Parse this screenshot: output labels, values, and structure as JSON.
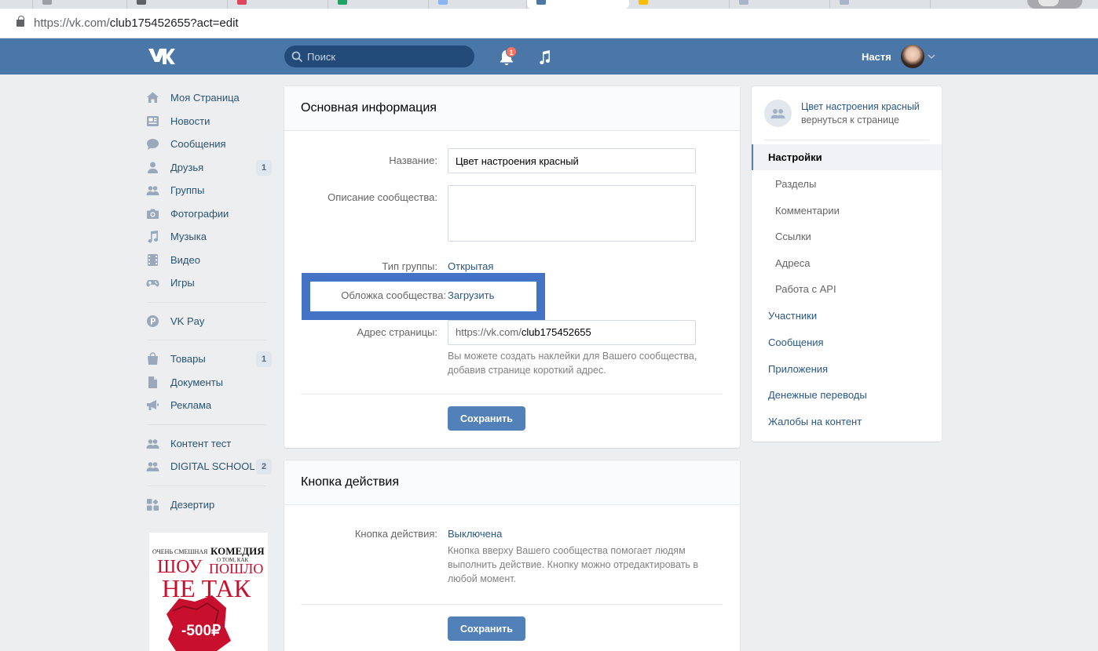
{
  "browser": {
    "url_host": "https://vk.com/",
    "url_path": "club175452655?act=edit"
  },
  "header": {
    "search_placeholder": "Поиск",
    "notifications_count": "1",
    "user_name": "Настя"
  },
  "left_nav": {
    "items": [
      {
        "label": "Моя Страница",
        "icon": "home-icon"
      },
      {
        "label": "Новости",
        "icon": "news-icon"
      },
      {
        "label": "Сообщения",
        "icon": "messages-icon"
      },
      {
        "label": "Друзья",
        "icon": "friends-icon",
        "count": "1"
      },
      {
        "label": "Группы",
        "icon": "groups-icon"
      },
      {
        "label": "Фотографии",
        "icon": "camera-icon"
      },
      {
        "label": "Музыка",
        "icon": "music-note-icon"
      },
      {
        "label": "Видео",
        "icon": "video-icon"
      },
      {
        "label": "Игры",
        "icon": "gamepad-icon"
      },
      {
        "label": "VK Pay",
        "icon": "vkpay-icon"
      },
      {
        "label": "Товары",
        "icon": "shopping-bag-icon",
        "count": "1"
      },
      {
        "label": "Документы",
        "icon": "document-icon"
      },
      {
        "label": "Реклама",
        "icon": "megaphone-icon"
      },
      {
        "label": "Контент тест",
        "icon": "community-icon"
      },
      {
        "label": "DIGITAL SCHOOL",
        "icon": "community-icon",
        "count": "2"
      },
      {
        "label": "Дезертир",
        "icon": "app-grid-icon"
      }
    ]
  },
  "ad": {
    "line1": "ОЧЕНЬ СМЕШНАЯ",
    "line1b": "КОМЕДИЯ",
    "line2": "О ТОМ, КАК",
    "line3a": "ШОУ",
    "line3b": "ПОШЛО",
    "line4": "НЕ ТАК",
    "badge": "-500₽"
  },
  "main_info": {
    "title": "Основная информация",
    "name_label": "Название:",
    "name_value": "Цвет настроения красный",
    "description_label": "Описание сообщества:",
    "description_value": "",
    "group_type_label": "Тип группы:",
    "group_type_value": "Открытая",
    "cover_label": "Обложка сообщества:",
    "cover_link": "Загрузить",
    "address_label": "Адрес страницы:",
    "address_prefix": "https://vk.com/",
    "address_value": "club175452655",
    "address_hint_1": "Вы можете создать наклейки для Вашего сообщества,",
    "address_hint_2": "добавив странице короткий адрес.",
    "save_label": "Сохранить"
  },
  "action_button": {
    "title": "Кнопка действия",
    "label": "Кнопка действия:",
    "value": "Выключена",
    "hint_1": "Кнопка вверху Вашего сообщества помогает людям",
    "hint_2": "выполнить действие. Кнопку можно отредактировать в",
    "hint_3": "любой момент.",
    "save_label": "Сохранить"
  },
  "right_menu": {
    "group_name": "Цвет настроения красный",
    "back_link": "вернуться к странице",
    "items": [
      {
        "label": "Настройки",
        "level": "top",
        "selected": true
      },
      {
        "label": "Разделы",
        "level": "sub"
      },
      {
        "label": "Комментарии",
        "level": "sub"
      },
      {
        "label": "Ссылки",
        "level": "sub"
      },
      {
        "label": "Адреса",
        "level": "sub"
      },
      {
        "label": "Работа с API",
        "level": "sub"
      },
      {
        "label": "Участники",
        "level": "top"
      },
      {
        "label": "Сообщения",
        "level": "top"
      },
      {
        "label": "Приложения",
        "level": "top"
      },
      {
        "label": "Денежные переводы",
        "level": "top"
      },
      {
        "label": "Жалобы на контент",
        "level": "top"
      }
    ]
  },
  "colors": {
    "vk_blue": "#4a76a8",
    "button_blue": "#5181b8",
    "link_blue": "#2a5885",
    "highlight_blue": "#4472c4",
    "ad_red": "#c8102e"
  }
}
